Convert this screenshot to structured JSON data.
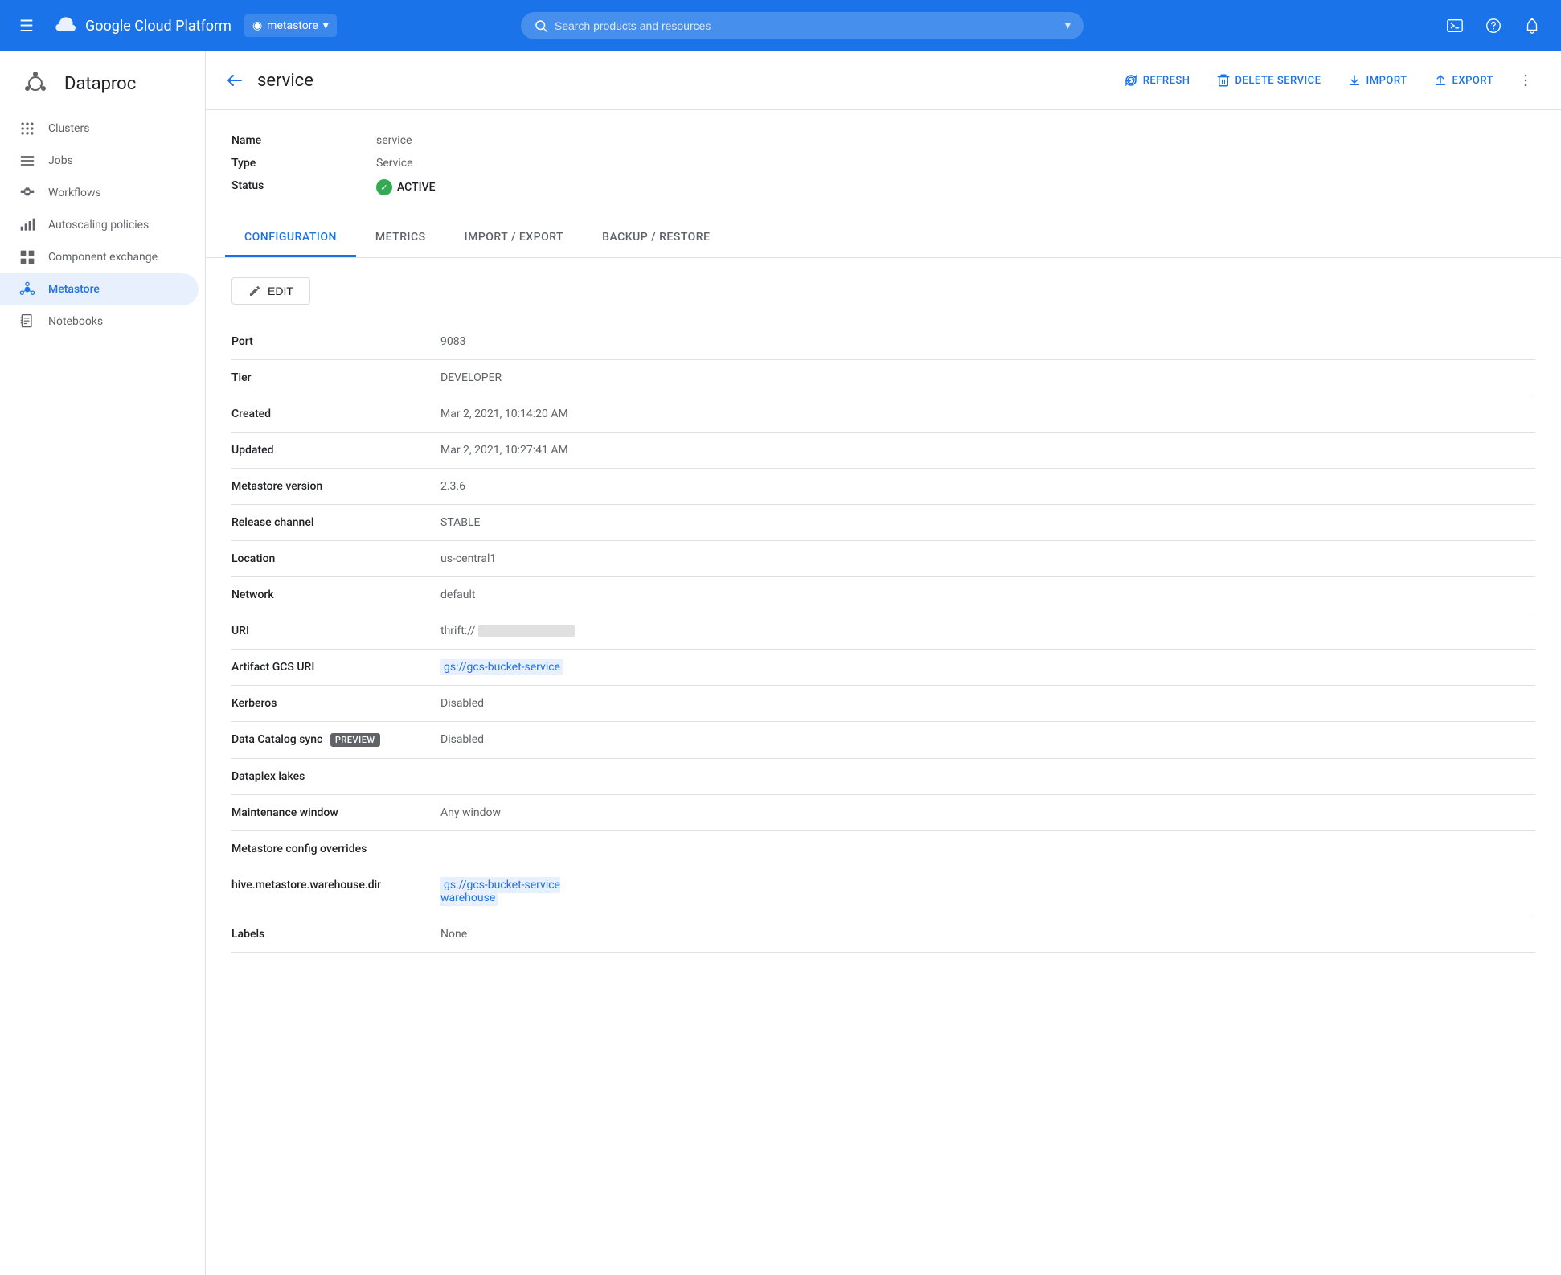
{
  "topnav": {
    "hamburger_label": "☰",
    "brand_title": "Google Cloud Platform",
    "project_name": "metastore",
    "project_icon": "◉",
    "search_placeholder": "Search products and resources",
    "search_expand_icon": "▾",
    "terminal_icon": ">_",
    "help_icon": "?",
    "notification_icon": "🔔"
  },
  "sidebar": {
    "app_name": "Dataproc",
    "items": [
      {
        "id": "clusters",
        "label": "Clusters",
        "icon": "⣿"
      },
      {
        "id": "jobs",
        "label": "Jobs",
        "icon": "≡"
      },
      {
        "id": "workflows",
        "label": "Workflows",
        "icon": "⬡"
      },
      {
        "id": "autoscaling",
        "label": "Autoscaling policies",
        "icon": "▐"
      },
      {
        "id": "component-exchange",
        "label": "Component exchange",
        "icon": "⊞"
      },
      {
        "id": "metastore",
        "label": "Metastore",
        "icon": "⟡"
      },
      {
        "id": "notebooks",
        "label": "Notebooks",
        "icon": "📄"
      }
    ]
  },
  "page": {
    "back_icon": "←",
    "title": "service",
    "actions": {
      "refresh_label": "REFRESH",
      "refresh_icon": "↺",
      "delete_label": "DELETE SERVICE",
      "delete_icon": "🗑",
      "import_label": "IMPORT",
      "import_icon": "⬇",
      "export_label": "EXPORT",
      "export_icon": "⬆",
      "more_icon": "⋮"
    }
  },
  "service_info": {
    "name_label": "Name",
    "name_value": "service",
    "type_label": "Type",
    "type_value": "Service",
    "status_label": "Status",
    "status_value": "ACTIVE"
  },
  "tabs": [
    {
      "id": "configuration",
      "label": "CONFIGURATION",
      "active": true
    },
    {
      "id": "metrics",
      "label": "METRICS",
      "active": false
    },
    {
      "id": "import-export",
      "label": "IMPORT / EXPORT",
      "active": false
    },
    {
      "id": "backup-restore",
      "label": "BACKUP / RESTORE",
      "active": false
    }
  ],
  "edit_button": "✏ EDIT",
  "config": {
    "rows": [
      {
        "label": "Port",
        "value": "9083",
        "type": "text"
      },
      {
        "label": "Tier",
        "value": "DEVELOPER",
        "type": "text"
      },
      {
        "label": "Created",
        "value": "Mar 2, 2021, 10:14:20 AM",
        "type": "text"
      },
      {
        "label": "Updated",
        "value": "Mar 2, 2021, 10:27:41 AM",
        "type": "text"
      },
      {
        "label": "Metastore version",
        "value": "2.3.6",
        "type": "text"
      },
      {
        "label": "Release channel",
        "value": "STABLE",
        "type": "text"
      },
      {
        "label": "Location",
        "value": "us-central1",
        "type": "text"
      },
      {
        "label": "Network",
        "value": "default",
        "type": "text"
      },
      {
        "label": "URI",
        "value": "thrift://",
        "type": "uri"
      },
      {
        "label": "Artifact GCS URI",
        "value": "gs://gcs-bucket-service",
        "type": "link-highlight"
      },
      {
        "label": "Kerberos",
        "value": "Disabled",
        "type": "text"
      },
      {
        "label": "Data Catalog sync",
        "value": "Disabled",
        "type": "preview",
        "preview_text": "PREVIEW"
      },
      {
        "label": "Dataplex lakes",
        "value": "",
        "type": "text"
      },
      {
        "label": "Maintenance window",
        "value": "Any window",
        "type": "text"
      },
      {
        "label": "Metastore config overrides",
        "value": "",
        "type": "text"
      },
      {
        "label": "hive.metastore.warehouse.dir",
        "value": "gs://gcs-bucket-service\nwarehouse",
        "type": "link-indented"
      },
      {
        "label": "Labels",
        "value": "None",
        "type": "text"
      }
    ]
  }
}
